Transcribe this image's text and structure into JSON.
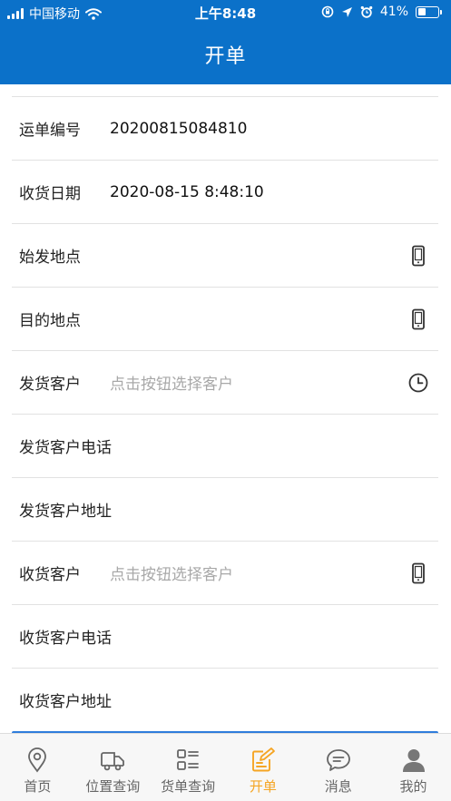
{
  "status_bar": {
    "carrier": "中国移动",
    "time": "上午8:48",
    "battery": "41%",
    "battery_level": 0.41
  },
  "nav": {
    "title": "开单"
  },
  "form": {
    "rows": [
      {
        "label": "运单编号",
        "value": "20200815084810"
      },
      {
        "label": "收货日期",
        "value": "2020-08-15 8:48:10"
      },
      {
        "label": "始发地点",
        "icon": "phone-icon"
      },
      {
        "label": "目的地点",
        "icon": "phone-icon"
      },
      {
        "label": "发货客户",
        "placeholder": "点击按钮选择客户",
        "icon": "clock-icon"
      },
      {
        "label": "发货客户电话"
      },
      {
        "label": "发货客户地址"
      },
      {
        "label": "收货客户",
        "placeholder": "点击按钮选择客户",
        "icon": "phone-icon"
      },
      {
        "label": "收货客户电话"
      },
      {
        "label": "收货客户地址"
      }
    ]
  },
  "tabbar": {
    "tabs": [
      {
        "label": "首页",
        "icon": "location-pin-icon"
      },
      {
        "label": "位置查询",
        "icon": "truck-icon"
      },
      {
        "label": "货单查询",
        "icon": "list-icon"
      },
      {
        "label": "开单",
        "icon": "edit-note-icon",
        "active": true
      },
      {
        "label": "消息",
        "icon": "chat-bubble-icon"
      },
      {
        "label": "我的",
        "icon": "user-icon"
      }
    ],
    "active_color": "#f5a524",
    "inactive_color": "#666666"
  },
  "colors": {
    "header": "#0b71c9",
    "placeholder": "#a8a8a8"
  }
}
